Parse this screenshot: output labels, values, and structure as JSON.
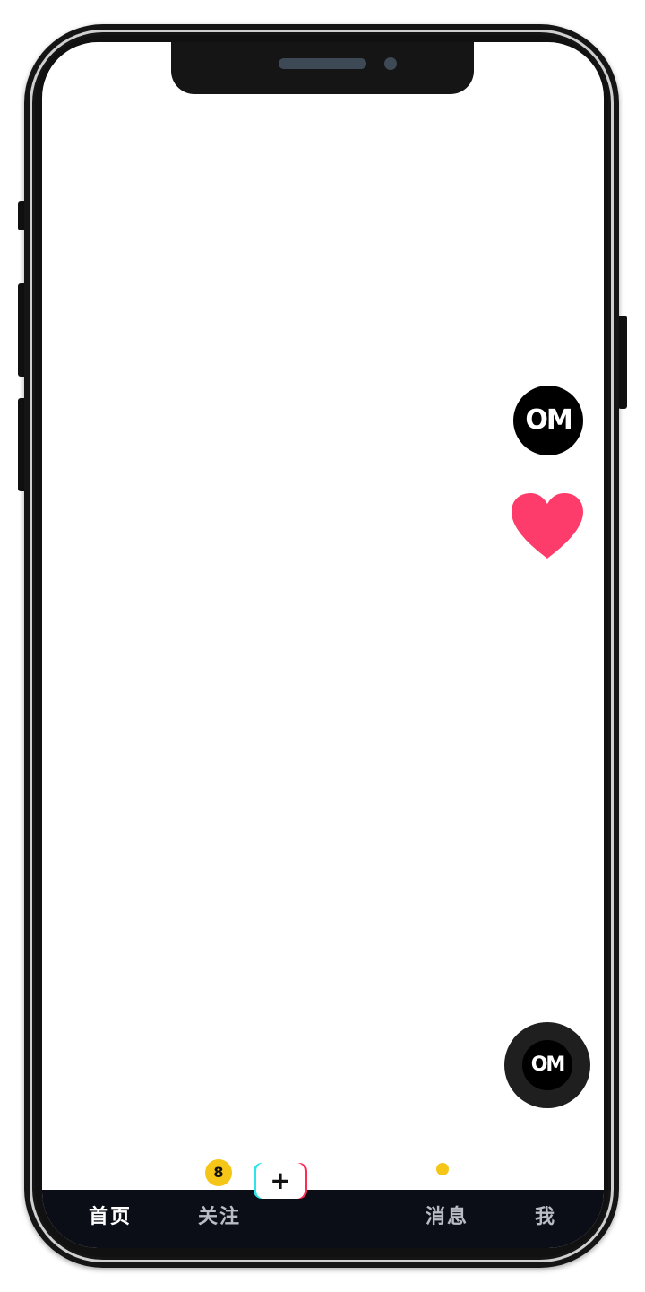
{
  "tabs": [
    {
      "label": "首页",
      "active": true
    },
    {
      "label": "关注",
      "badge": "8"
    },
    {
      "label": "消息",
      "dot": true
    },
    {
      "label": "我"
    }
  ],
  "create_button": {
    "label": "+"
  },
  "avatar": {
    "logo_text": "OM"
  },
  "music_disc": {
    "logo_text": "OM"
  },
  "icons": {
    "like": "heart-icon",
    "create": "plus-icon"
  },
  "colors": {
    "heart": "#fe3c6c",
    "badge": "#f5c518",
    "tabbar": "#0b0e17",
    "create_cyan": "#2ee4e8",
    "create_red": "#fe2c55"
  }
}
